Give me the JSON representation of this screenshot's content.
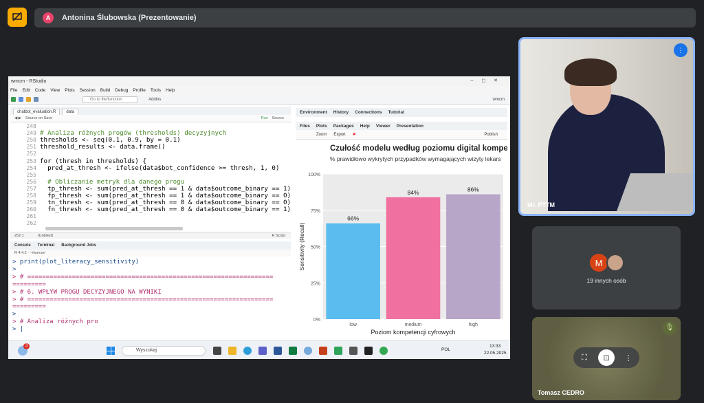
{
  "meet": {
    "presenter_initial": "A",
    "presenter_label": "Antonina Ślubowska (Prezentowanie)"
  },
  "rstudio": {
    "window_title": "wmcm - RStudio",
    "menu": [
      "File",
      "Edit",
      "Code",
      "View",
      "Plots",
      "Session",
      "Build",
      "Debug",
      "Profile",
      "Tools",
      "Help"
    ],
    "goto_placeholder": "Go to file/function",
    "addins": "Addins",
    "project": "wmcm",
    "editor_tabs": [
      "chatbot_evaluation.R",
      "data"
    ],
    "source_on_save": "Source on Save",
    "run_label": "Run",
    "source_label": "Source",
    "code_lines": [
      {
        "n": "248",
        "t": ""
      },
      {
        "n": "249",
        "t": "# Analiza różnych progów (thresholds) decyzyjnych",
        "c": "cm"
      },
      {
        "n": "250",
        "t": "thresholds <- seq(0.1, 0.9, by = 0.1)"
      },
      {
        "n": "251",
        "t": "threshold_results <- data.frame()"
      },
      {
        "n": "252",
        "t": ""
      },
      {
        "n": "253",
        "t": "for (thresh in thresholds) {"
      },
      {
        "n": "254",
        "t": "  pred_at_thresh <- ifelse(data$bot_confidence >= thresh, 1, 0)"
      },
      {
        "n": "255",
        "t": ""
      },
      {
        "n": "256",
        "t": "  # Obliczanie metryk dla danego progu",
        "c": "cm"
      },
      {
        "n": "257",
        "t": "  tp_thresh <- sum(pred_at_thresh == 1 & data$outcome_binary == 1)"
      },
      {
        "n": "258",
        "t": "  fp_thresh <- sum(pred_at_thresh == 1 & data$outcome_binary == 0)"
      },
      {
        "n": "259",
        "t": "  tn_thresh <- sum(pred_at_thresh == 0 & data$outcome_binary == 0)"
      },
      {
        "n": "260",
        "t": "  fn_thresh <- sum(pred_at_thresh == 0 & data$outcome_binary == 1)"
      },
      {
        "n": "261",
        "t": ""
      },
      {
        "n": "262",
        "t": ""
      }
    ],
    "editor_status_pos": "252:1",
    "editor_status_scope": "(Untitled)",
    "editor_status_type": "R Script",
    "console_tabs": [
      "Console",
      "Terminal",
      "Background Jobs"
    ],
    "console_header": "R 4.4.2 · ~/wmcm/",
    "console_lines": [
      {
        "t": "> print(plot_literacy_sensitivity)",
        "c": "prompt"
      },
      {
        "t": ">",
        "c": "prompt"
      },
      {
        "t": "> # ==================================================================",
        "c": "pink"
      },
      {
        "t": "=========",
        "c": "pink"
      },
      {
        "t": "> # 6. WPŁYW PROGU DECYZYJNEGO NA WYNIKI",
        "c": "pink"
      },
      {
        "t": "> # ==================================================================",
        "c": "pink"
      },
      {
        "t": "=========",
        "c": "pink"
      },
      {
        "t": ">",
        "c": "prompt"
      },
      {
        "t": "> # Analiza różnych pro",
        "c": "pink"
      },
      {
        "t": "> |",
        "c": "prompt"
      }
    ],
    "env_tabs": [
      "Environment",
      "History",
      "Connections",
      "Tutorial"
    ],
    "file_tabs": [
      "Files",
      "Plots",
      "Packages",
      "Help",
      "Viewer",
      "Presentation"
    ],
    "plot_tools": {
      "zoom": "Zoom",
      "export": "Export",
      "publish": "Publish"
    }
  },
  "chart_data": {
    "type": "bar",
    "title": "Czułość modelu według poziomu digital kompeten",
    "subtitle": "% prawidłowo wykrytych przypadków wymagających wizyty lekars",
    "xlabel": "Poziom kompetencji cyfrowych",
    "ylabel": "Sensitivity (Recall)",
    "categories": [
      "low",
      "medium",
      "high"
    ],
    "values": [
      66,
      84,
      86
    ],
    "value_labels": [
      "66%",
      "84%",
      "86%"
    ],
    "colors": [
      "#5bbcef",
      "#f070a0",
      "#b8a6c9"
    ],
    "ylim": [
      0,
      100
    ],
    "yticks": [
      "0%",
      "25%",
      "50%",
      "75%",
      "100%"
    ],
    "grid": true
  },
  "taskbar": {
    "search_placeholder": "Wyszukaj",
    "notif_count": "3",
    "lang": "POL",
    "time": "13:33",
    "date": "22.05.2025"
  },
  "participants": {
    "main_name": "Mr. PTTM",
    "others_initial": "M",
    "others_label": "19 innych osób",
    "third_name": "Tomasz CEDRO"
  }
}
